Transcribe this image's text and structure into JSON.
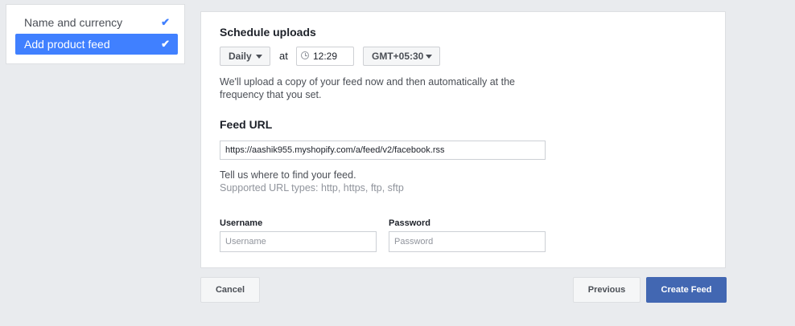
{
  "steps": {
    "items": [
      {
        "label": "Name and currency",
        "check": "✔"
      },
      {
        "label": "Add product feed",
        "check": "✔"
      }
    ]
  },
  "schedule": {
    "title": "Schedule uploads",
    "frequency": "Daily",
    "at_label": "at",
    "time": "12:29",
    "timezone": "GMT+05:30",
    "description": "We'll upload a copy of your feed now and then automatically at the frequency that you set."
  },
  "feed": {
    "title": "Feed URL",
    "url": "https://aashik955.myshopify.com/a/feed/v2/facebook.rss",
    "help": "Tell us where to find your feed.",
    "supported": "Supported URL types: http, https, ftp, sftp"
  },
  "credentials": {
    "username_label": "Username",
    "username_placeholder": "Username",
    "password_label": "Password",
    "password_placeholder": "Password"
  },
  "footer": {
    "cancel": "Cancel",
    "previous": "Previous",
    "create": "Create Feed"
  },
  "colors": {
    "accent": "#4080ff",
    "primary_button": "#4267b2",
    "background": "#e9ebee"
  }
}
